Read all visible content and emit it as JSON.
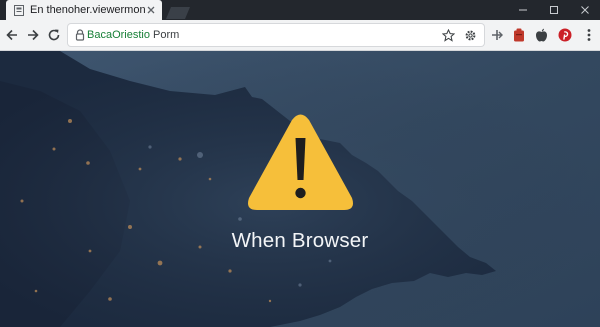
{
  "window": {
    "tab_title": "En thenoher.viewermon.",
    "icons": {
      "favicon": "page-icon",
      "tab_close": "close-icon",
      "new_tab": "new-tab-icon",
      "minimize": "minimize-icon",
      "maximize": "maximize-icon",
      "close": "window-close-icon"
    }
  },
  "toolbar": {
    "url_host": "BacaOriestio",
    "url_rest": " Porm",
    "icons": [
      "back-icon",
      "forward-icon",
      "reload-icon",
      "lock-icon",
      "bookmark-star-icon",
      "settings-gear-icon"
    ]
  },
  "extensions": [
    "pin-extension-icon",
    "puzzle-extension-icon",
    "apple-icon",
    "pinterest-icon",
    "kebab-menu-icon"
  ],
  "colors": {
    "tab_strip": "#23272d",
    "toolbar": "#f2f3f4",
    "warning_yellow": "#f6bf3a",
    "background": "#2b3c52"
  },
  "main": {
    "message": "When Browser",
    "icon": "warning-triangle-icon"
  }
}
